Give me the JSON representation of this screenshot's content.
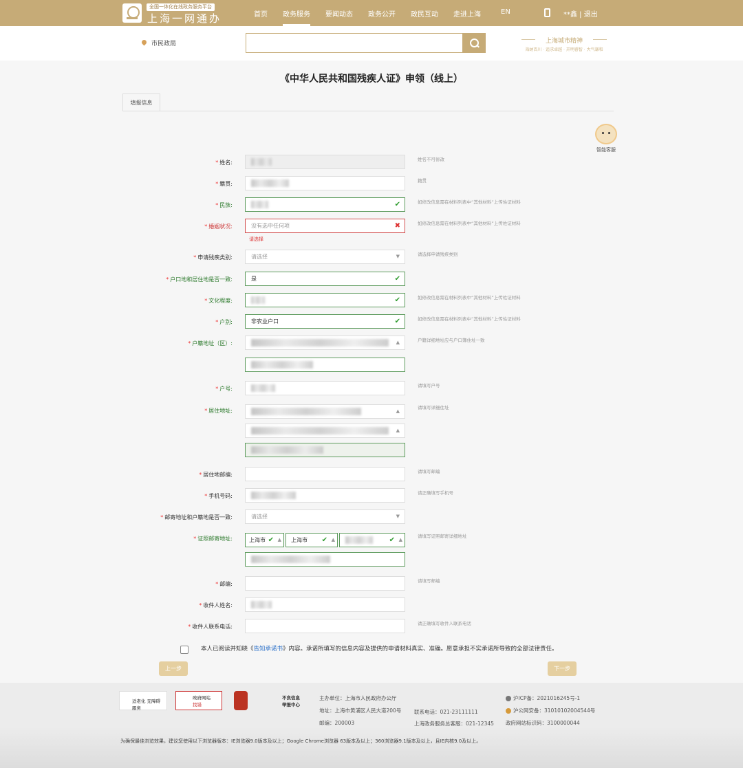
{
  "header": {
    "logo_subtitle": "全国一体化在线政务服务平台",
    "logo_title": "上海一网通办",
    "nav": [
      "首页",
      "政务服务",
      "要闻动态",
      "政务公开",
      "政民互动",
      "走进上海",
      "EN"
    ],
    "active_nav": "政务服务",
    "user_text": "**鑫 | 退出"
  },
  "subbar": {
    "location": "市民政局",
    "search_placeholder": "",
    "spirit_title": "上海城市精神",
    "spirit_sub": "海纳百川 · 追求卓越 · 开明睿智 · 大气谦和"
  },
  "page": {
    "title": "《中华人民共和国残疾人证》申领（线上）",
    "tab": "填报信息",
    "bot_label": "智能客服"
  },
  "form": {
    "name_label": "姓名:",
    "name_hint": "姓名不可修改",
    "native_label": "籍贯:",
    "native_hint": "籍贯",
    "ethnic_label": "民族:",
    "ethnic_hint": "如修改信息需在材料列表中“其他材料”上传佐证材料",
    "marital_label": "婚姻状况:",
    "marital_placeholder": "没有选中任何项",
    "marital_error": "请选择",
    "marital_hint": "如修改信息需在材料列表中“其他材料”上传佐证材料",
    "category_label": "申请残疾类别:",
    "category_placeholder": "请选择",
    "category_hint": "请选择申请残疾类别",
    "same_addr_label": "户口地和居住地是否一致:",
    "same_addr_value": "是",
    "edu_label": "文化程度:",
    "edu_hint": "如修改信息需在材料列表中“其他材料”上传佐证材料",
    "hukou_type_label": "户别:",
    "hukou_type_value": "非农业户口",
    "hukou_type_hint": "如修改信息需在材料列表中“其他材料”上传佐证材料",
    "hukou_addr_label": "户籍地址（区）:",
    "hukou_addr_hint": "户籍详细地址应与户口簿住址一致",
    "hukou_no_label": "户号:",
    "hukou_no_hint": "请填写户号",
    "residence_label": "居住地址:",
    "residence_hint": "请填写详细住址",
    "residence_zip_label": "居住地邮编:",
    "residence_zip_hint": "请填写邮编",
    "phone_label": "手机号码:",
    "phone_hint": "请正确填写手机号",
    "mail_same_label": "邮寄地址和户籍地是否一致:",
    "mail_same_placeholder": "请选择",
    "cert_addr_label": "证照邮寄地址:",
    "cert_addr_city1": "上海市",
    "cert_addr_city2": "上海市",
    "cert_addr_hint": "请填写证照邮寄详细地址",
    "zip_label": "邮编:",
    "zip_hint": "请填写邮编",
    "receiver_label": "收件人姓名:",
    "receiver_phone_label": "收件人联系电话:",
    "receiver_phone_hint": "请正确填写收件人联系电话"
  },
  "agreement": {
    "before": "本人已阅读并知晓《",
    "link": "告知承诺书",
    "after": "》内容。承诺所填写的信息内容及提供的申请材料真实、准确。愿意承担不实承诺所导致的全部法律责任。"
  },
  "buttons": {
    "prev": "上一步",
    "next": "下一步"
  },
  "footer": {
    "badge1": "适老化 无障碍服务",
    "badge2_title": "政府网站",
    "badge2_sub": "找错",
    "badge4_title": "不良信息",
    "badge4_sub": "举报中心",
    "host": "主办单位：上海市人民政府办公厅",
    "address": "地址：上海市黄浦区人民大道200号",
    "zip": "邮编：200003",
    "tel": "联系电话：021-23111111",
    "service_tel": "上海政务服务总客服：021-12345",
    "icp": "沪ICP备：2021016245号-1",
    "police": "沪公网安备：31010102004544号",
    "site_code": "政府网站标识码：3100000044",
    "browser_note": "为确保最佳浏览效果，建议您使用以下浏览器版本：IE浏览器9.0版本及以上；Google Chrome浏览器 63版本及以上；360浏览器9.1版本及以上，且IE内核9.0及以上。"
  },
  "colors": {
    "brand": "#c6ab77",
    "ok": "#2d9b2d",
    "error": "#d33333",
    "link": "#2a6fc8"
  }
}
